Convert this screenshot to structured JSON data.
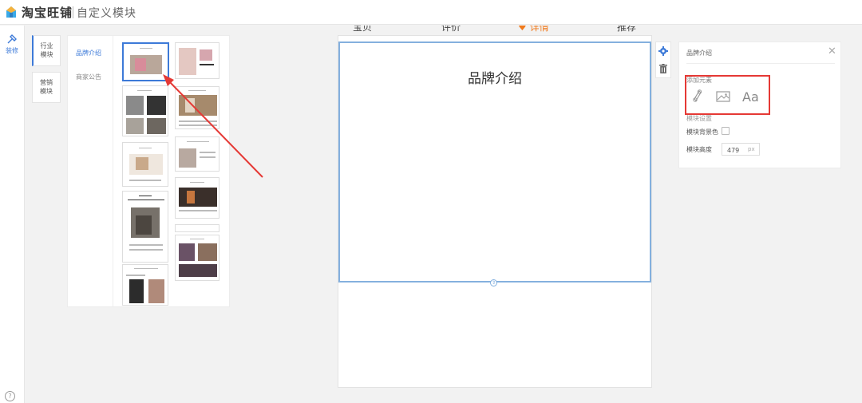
{
  "header": {
    "brand": "淘宝旺铺",
    "page_title": "自定义模块"
  },
  "rail": {
    "decorate_label": "装修",
    "help_glyph": "?"
  },
  "categories": [
    {
      "label": "行业\n模块",
      "active": true
    },
    {
      "label": "营销\n模块",
      "active": false
    }
  ],
  "sub_categories": [
    {
      "label": "品牌介绍",
      "active": true
    },
    {
      "label": "商家公告",
      "active": false
    }
  ],
  "thumbnails": {
    "count": 12,
    "selected_index": 0
  },
  "nav": {
    "items": [
      "宝贝",
      "评价",
      "详情",
      "推荐"
    ],
    "active_index": 2,
    "active_marker": "♥"
  },
  "module": {
    "title": "品牌介绍"
  },
  "tools": {
    "settings_icon": "gear-icon",
    "delete_icon": "trash-icon"
  },
  "settings": {
    "title": "品牌介绍",
    "close_glyph": "✕",
    "add_elements_label": "添加元素",
    "elements": [
      "link-icon",
      "image-icon",
      "Aa"
    ],
    "module_settings_label": "模块设置",
    "bg_color_label": "模块背景色",
    "height_label": "模块高度",
    "height_value": "479",
    "height_unit": "px"
  },
  "colors": {
    "accent": "#3d7ad8",
    "nav_active": "#f07a1c",
    "highlight": "#e53935",
    "module_border": "#84b0de"
  }
}
